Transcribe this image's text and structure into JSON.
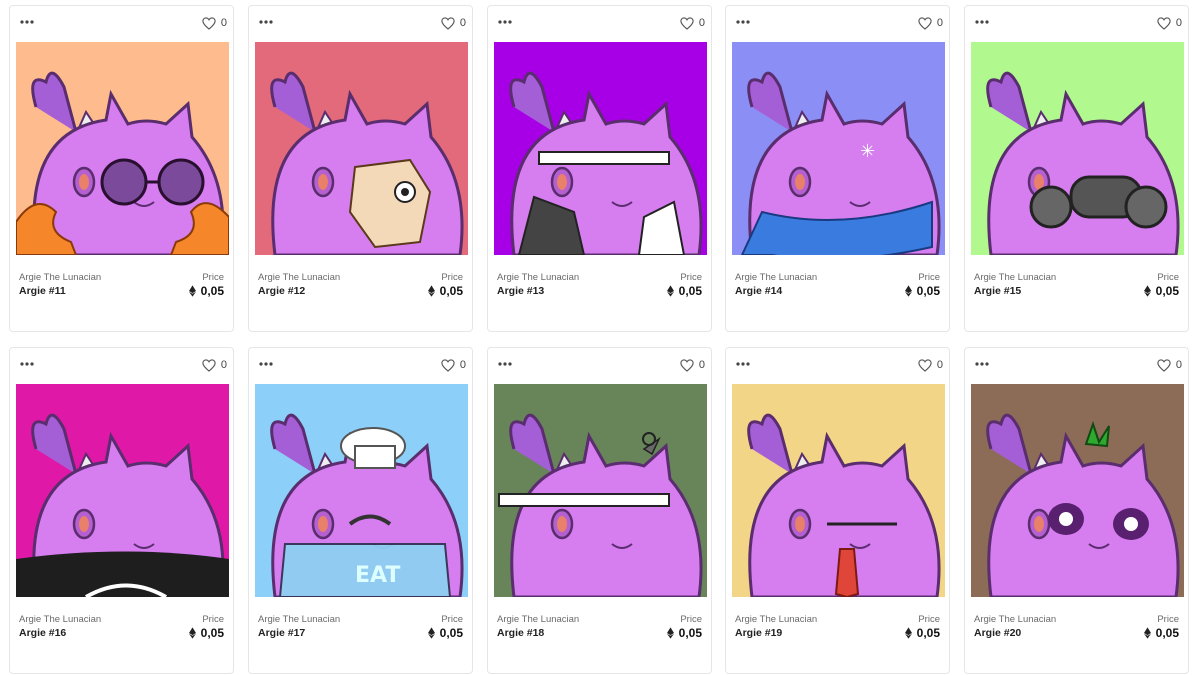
{
  "cards": [
    {
      "collection": "Argie The Lunacian",
      "name": "Argie #11",
      "price_label": "Price",
      "price": "0,05",
      "likes": "0",
      "bg": "#fdbb8e",
      "accessory": "sunglasses-fur"
    },
    {
      "collection": "Argie The Lunacian",
      "name": "Argie #12",
      "price_label": "Price",
      "price": "0,05",
      "likes": "0",
      "bg": "#e26a7b",
      "accessory": "paper-mask"
    },
    {
      "collection": "Argie The Lunacian",
      "name": "Argie #13",
      "price_label": "Price",
      "price": "0,05",
      "likes": "0",
      "bg": "#a700e6",
      "accessory": "headband-jacket"
    },
    {
      "collection": "Argie The Lunacian",
      "name": "Argie #14",
      "price_label": "Price",
      "price": "0,05",
      "likes": "0",
      "bg": "#8b8ff5",
      "accessory": "blue-scarf"
    },
    {
      "collection": "Argie The Lunacian",
      "name": "Argie #15",
      "price_label": "Price",
      "price": "0,05",
      "likes": "0",
      "bg": "#b1f98e",
      "accessory": "gas-mask"
    },
    {
      "collection": "Argie The Lunacian",
      "name": "Argie #16",
      "price_label": "Price",
      "price": "0,05",
      "likes": "0",
      "bg": "#e018a8",
      "accessory": "black-shirt"
    },
    {
      "collection": "Argie The Lunacian",
      "name": "Argie #17",
      "price_label": "Price",
      "price": "0,05",
      "likes": "0",
      "bg": "#8ccff9",
      "accessory": "chef-apron"
    },
    {
      "collection": "Argie The Lunacian",
      "name": "Argie #18",
      "price_label": "Price",
      "price": "0,05",
      "likes": "0",
      "bg": "#68855a",
      "accessory": "ninja-headband"
    },
    {
      "collection": "Argie The Lunacian",
      "name": "Argie #19",
      "price_label": "Price",
      "price": "0,05",
      "likes": "0",
      "bg": "#f2d586",
      "accessory": "red-tie"
    },
    {
      "collection": "Argie The Lunacian",
      "name": "Argie #20",
      "price_label": "Price",
      "price": "0,05",
      "likes": "0",
      "bg": "#8c6c57",
      "accessory": "punk-panda"
    }
  ],
  "apron_text": "EAT",
  "icons": {
    "more": "more-horizontal-icon",
    "like": "heart-icon",
    "currency": "ethereum-icon"
  },
  "colors": {
    "body": "#d67df0",
    "outline": "#5a2d6e",
    "tuft": "#a55fd6"
  }
}
